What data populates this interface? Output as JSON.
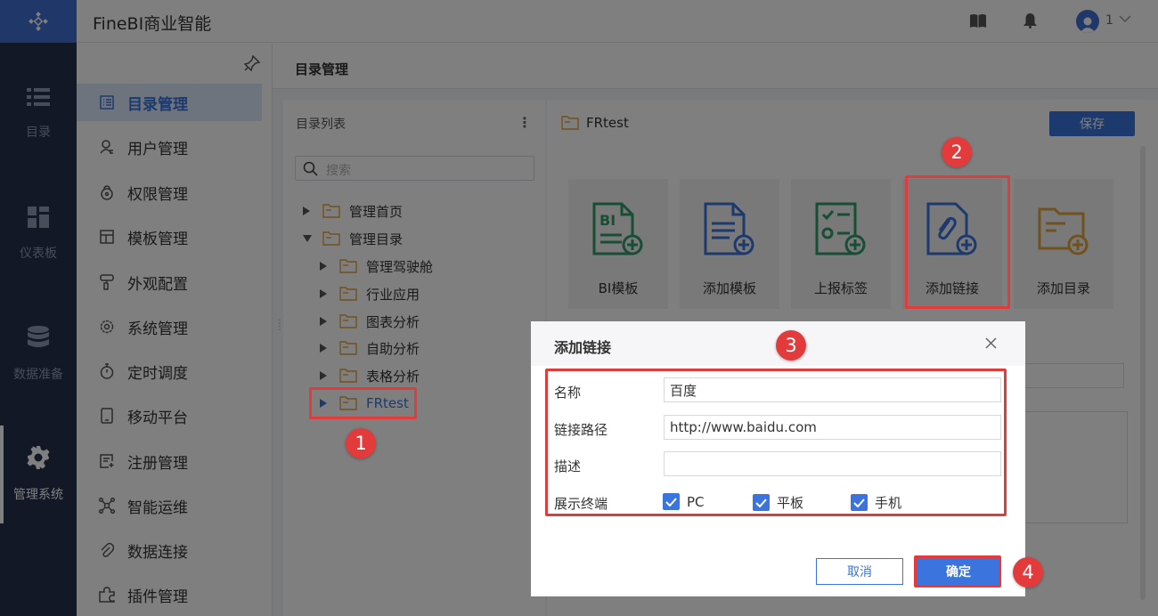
{
  "header": {
    "app_title": "FineBI商业智能",
    "user_name": "1"
  },
  "rail": {
    "items": [
      {
        "label": "目录",
        "icon": "list-icon"
      },
      {
        "label": "仪表板",
        "icon": "dashboard-grid-icon"
      },
      {
        "label": "数据准备",
        "icon": "database-icon"
      },
      {
        "label": "管理系统",
        "icon": "gear-icon"
      }
    ],
    "active": "管理系统"
  },
  "menu": {
    "items": [
      {
        "label": "目录管理",
        "icon": "catalog-icon"
      },
      {
        "label": "用户管理",
        "icon": "user-icon"
      },
      {
        "label": "权限管理",
        "icon": "lock-icon"
      },
      {
        "label": "模板管理",
        "icon": "template-icon"
      },
      {
        "label": "外观配置",
        "icon": "brush-icon"
      },
      {
        "label": "系统管理",
        "icon": "settings-icon"
      },
      {
        "label": "定时调度",
        "icon": "timer-icon"
      },
      {
        "label": "移动平台",
        "icon": "mobile-icon"
      },
      {
        "label": "注册管理",
        "icon": "register-icon"
      },
      {
        "label": "智能运维",
        "icon": "ops-icon"
      },
      {
        "label": "数据连接",
        "icon": "link-icon"
      },
      {
        "label": "插件管理",
        "icon": "plugin-icon"
      }
    ],
    "active": "目录管理"
  },
  "content": {
    "title": "目录管理"
  },
  "directory": {
    "title": "目录列表",
    "search_placeholder": "搜索",
    "tree": [
      {
        "label": "管理首页",
        "expanded": false
      },
      {
        "label": "管理目录",
        "expanded": true
      },
      {
        "label": "管理驾驶舱",
        "expanded": false
      },
      {
        "label": "行业应用",
        "expanded": false
      },
      {
        "label": "图表分析",
        "expanded": false
      },
      {
        "label": "自助分析",
        "expanded": false
      },
      {
        "label": "表格分析",
        "expanded": false
      },
      {
        "label": "FRtest",
        "expanded": false,
        "highlighted": true
      }
    ]
  },
  "main": {
    "breadcrumb": "FRtest",
    "save_label": "保存",
    "tiles": [
      {
        "label": "BI模板",
        "icon": "bi-template-add-icon",
        "color": "#2e9c6a"
      },
      {
        "label": "添加模板",
        "icon": "template-add-icon",
        "color": "#3b74dc"
      },
      {
        "label": "上报标签",
        "icon": "report-tag-add-icon",
        "color": "#2e9c6a"
      },
      {
        "label": "添加链接",
        "icon": "link-add-icon",
        "color": "#3b74dc"
      },
      {
        "label": "添加目录",
        "icon": "folder-add-icon",
        "color": "#e3a23b"
      }
    ]
  },
  "dialog": {
    "title": "添加链接",
    "name_label": "名称",
    "name_value": "百度",
    "url_label": "链接路径",
    "url_value": "http://www.baidu.com",
    "desc_label": "描述",
    "desc_value": "",
    "terminal_label": "展示终端",
    "terminals": [
      {
        "label": "PC",
        "checked": true
      },
      {
        "label": "平板",
        "checked": true
      },
      {
        "label": "手机",
        "checked": true
      }
    ],
    "cancel_label": "取消",
    "ok_label": "确定"
  },
  "annotations": {
    "badges": [
      "1",
      "2",
      "3",
      "4"
    ],
    "highlight_color": "#e33b3b"
  },
  "colors": {
    "accent": "#3b74dc",
    "rail_bg": "#24314a",
    "folder": "#e3a23b"
  }
}
